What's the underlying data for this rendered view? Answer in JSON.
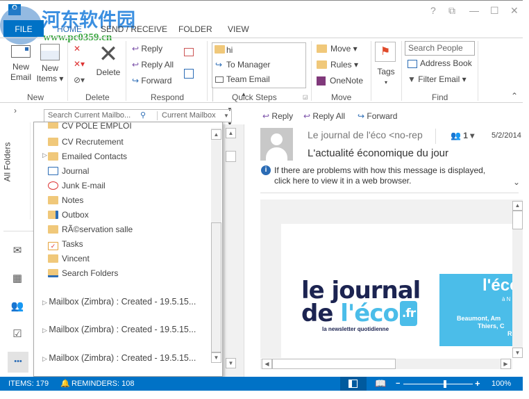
{
  "watermark": {
    "name": "河东软件园",
    "url": "www.pc0359.cn"
  },
  "window_controls": {
    "help": "?",
    "restore": "⧉",
    "minimize": "—",
    "maximize": "☐",
    "close": "✕"
  },
  "tabs": [
    "FILE",
    "HOME",
    "SEND / RECEIVE",
    "FOLDER",
    "VIEW"
  ],
  "ribbon": {
    "new": {
      "label": "New",
      "new_email": [
        "New",
        "Email"
      ],
      "new_items": [
        "New",
        "Items ▾"
      ]
    },
    "delete": {
      "label": "Delete",
      "delete": "Delete"
    },
    "respond": {
      "label": "Respond",
      "reply": "Reply",
      "reply_all": "Reply All",
      "forward": "Forward"
    },
    "quick_steps": {
      "label": "Quick Steps",
      "items": [
        "hi",
        "To Manager",
        "Team Email"
      ]
    },
    "move": {
      "label": "Move",
      "move": "Move ▾",
      "rules": "Rules ▾",
      "onenote": "OneNote"
    },
    "tags": {
      "label": "Tags"
    },
    "find": {
      "label": "Find",
      "search_people": "Search People",
      "address_book": "Address Book",
      "filter_email": "Filter Email ▾"
    }
  },
  "nav": {
    "all_folders": "All Folders",
    "more": "•••"
  },
  "search": {
    "placeholder": "Search Current Mailbo...",
    "scope": "Current Mailbox"
  },
  "folders": [
    "CV POLE EMPLOI",
    "CV Recrutement",
    "Emailed Contacts",
    "Journal",
    "Junk E-mail",
    "Notes",
    "Outbox",
    "RÃ©servation salle",
    "Tasks",
    "Vincent",
    "Search Folders"
  ],
  "mailboxes": [
    "Mailbox (Zimbra) : Created - 19.5.15...",
    "Mailbox (Zimbra) : Created - 19.5.15...",
    "Mailbox (Zimbra) : Created - 19.5.15..."
  ],
  "reading": {
    "reply": "Reply",
    "reply_all": "Reply All",
    "forward": "Forward",
    "sender": "Le journal de l'éco <no-rep",
    "people_count": "1 ▾",
    "date": "5/2/2014",
    "subject": "L'actualité économique du jour",
    "info": "If there are problems with how this message is displayed, click here to view it in a web browser.",
    "logo": {
      "line1": "le journal",
      "line2a": "de ",
      "line2b": "l'éco",
      "tld": ".fr",
      "tagline": "la newsletter quotidienne"
    },
    "banner": {
      "title": "l'éco",
      "sub": "à N",
      "text1": "Beaumont, Am",
      "text2": "Thiers, C",
      "text3": "R"
    }
  },
  "status": {
    "items": "ITEMS: 179",
    "reminders": "REMINDERS: 108",
    "zoom": "100%",
    "zoom_level": 0.6
  },
  "colors": {
    "accent": "#0072C6",
    "folder": "#F0C87A",
    "logo_dark": "#1C2451",
    "logo_light": "#4BBDE9"
  }
}
